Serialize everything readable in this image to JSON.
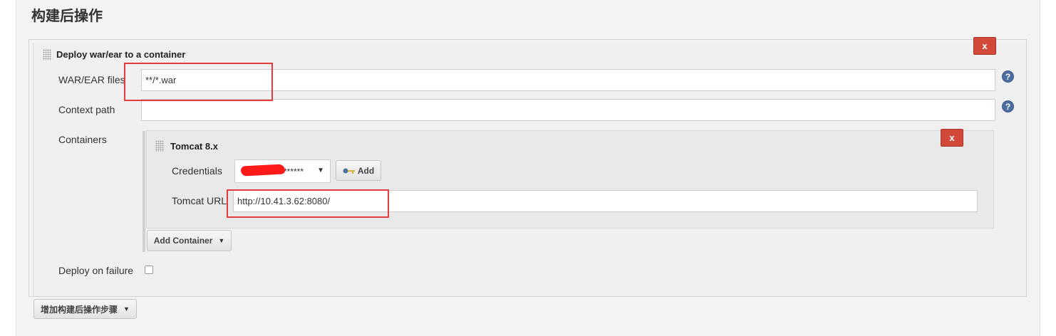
{
  "section": {
    "title": "构建后操作"
  },
  "deploy": {
    "title": "Deploy war/ear to a container",
    "delete_label": "x",
    "war_ear_files": {
      "label": "WAR/EAR files",
      "value": "**/*.war"
    },
    "context_path": {
      "label": "Context path",
      "value": ""
    },
    "help_label": "?",
    "containers_label": "Containers",
    "tomcat": {
      "title": "Tomcat 8.x",
      "delete_label": "x",
      "credentials_label": "Credentials",
      "credentials_value": "******",
      "add_label": "Add",
      "url_label": "Tomcat URL",
      "url_value": "http://10.41.3.62:8080/"
    },
    "add_container_label": "Add Container",
    "deploy_on_failure_label": "Deploy on failure",
    "deploy_on_failure_checked": false
  },
  "add_post_build_label": "增加构建后操作步骤",
  "colors": {
    "delete": "#d24939",
    "help": "#4d6fa0",
    "annotation": "#e83a3a"
  }
}
